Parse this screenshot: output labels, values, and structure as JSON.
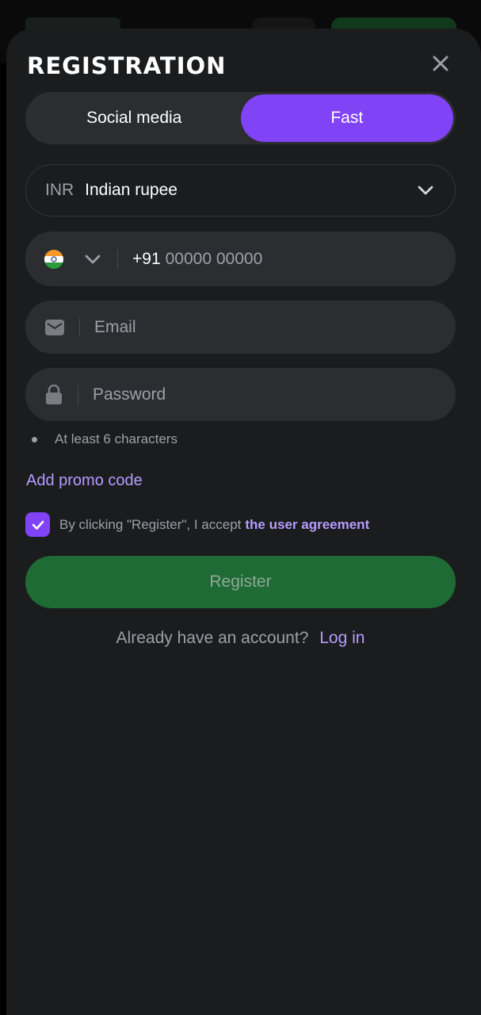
{
  "modal": {
    "title": "REGISTRATION"
  },
  "tabs": [
    {
      "label": "Social media",
      "active": false
    },
    {
      "label": "Fast",
      "active": true
    }
  ],
  "currency": {
    "code": "INR",
    "name": "Indian rupee"
  },
  "phone": {
    "country": "India",
    "prefix": "+91",
    "placeholder": "00000 00000"
  },
  "email": {
    "placeholder": "Email"
  },
  "password": {
    "placeholder": "Password",
    "hint": "At least 6 characters"
  },
  "promo": {
    "label": "Add promo code"
  },
  "agreement": {
    "checked": true,
    "text": "By clicking \"Register\", I accept",
    "link": "the user agreement"
  },
  "register": {
    "label": "Register"
  },
  "login": {
    "prompt": "Already have an account?",
    "link": "Log in"
  },
  "colors": {
    "accent": "#8143f6",
    "link": "#b69cff",
    "register_bg": "#1e6b35",
    "sheet_bg": "#1b1c1e",
    "field_bg": "#2b2d30"
  },
  "icons": {
    "close": "close-icon",
    "chevron": "chevron-down-icon",
    "email": "envelope-icon",
    "password": "lock-icon",
    "check": "checkmark-icon",
    "flag": "india-flag-icon"
  }
}
